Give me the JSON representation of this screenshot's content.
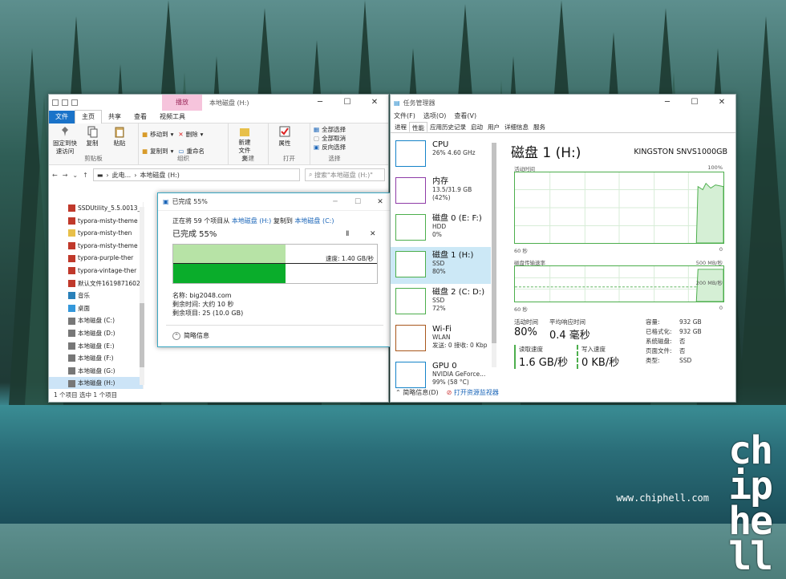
{
  "explorer": {
    "context_tab": "播放",
    "title": "本地磁盘 (H:)",
    "tabs": [
      "文件",
      "主页",
      "共享",
      "查看",
      "视频工具"
    ],
    "ribbon": {
      "clipboard": {
        "pin": "固定到快速访问",
        "copy": "复制",
        "paste": "粘贴",
        "label": "剪贴板"
      },
      "organize": {
        "move": "移动到",
        "delete": "删除",
        "copyto": "复制到",
        "rename": "重命名",
        "label": "组织"
      },
      "new": {
        "folder": "新建文件夹",
        "label": "新建"
      },
      "open": {
        "props": "属性",
        "label": "打开"
      },
      "select": {
        "all": "全部选择",
        "none": "全部取消",
        "invert": "反向选择",
        "label": "选择"
      }
    },
    "address": {
      "path1": "此电...",
      "path2": "本地磁盘 (H:)",
      "search_placeholder": "搜索\"本地磁盘 (H:)\""
    },
    "nav": [
      "SSDUtility_5.5.0013_",
      "typora-misty-theme",
      "typora-misty-then",
      "typora-misty-theme",
      "typora-purple-ther",
      "typora-vintage-ther",
      "默认文件1619871602",
      "音乐",
      "桌面",
      "本地磁盘 (C:)",
      "本地磁盘 (D:)",
      "本地磁盘 (E:)",
      "本地磁盘 (F:)",
      "本地磁盘 (G:)",
      "本地磁盘 (H:)"
    ],
    "status": "1 个项目    选中 1 个项目"
  },
  "copy": {
    "title": "已完成 55%",
    "line1_prefix": "正在将 59 个项目从",
    "line1_src": "本地磁盘 (H:)",
    "line1_mid": "复制到",
    "line1_dst": "本地磁盘 (C:)",
    "progress_text": "已完成 55%",
    "progress": 0.55,
    "speed": "速度: 1.40 GB/秒",
    "name": "名称: big2048.com",
    "remaining_time": "剩余时间: 大约 10 秒",
    "remaining_items": "剩余项目: 25 (10.0 GB)",
    "less": "简略信息",
    "pause": "Ⅱ",
    "close": "✕"
  },
  "task": {
    "title": "任务管理器",
    "menu": [
      "文件(F)",
      "选项(O)",
      "查看(V)"
    ],
    "tabs": [
      "进程",
      "性能",
      "应用历史记录",
      "启动",
      "用户",
      "详细信息",
      "服务"
    ],
    "side": [
      {
        "name": "CPU",
        "sub1": "26% 4.60 GHz",
        "sub2": "",
        "color": "#1583c8"
      },
      {
        "name": "内存",
        "sub1": "13.5/31.9 GB (42%)",
        "sub2": "",
        "color": "#8e3ca7"
      },
      {
        "name": "磁盘 0 (E: F:)",
        "sub1": "HDD",
        "sub2": "0%",
        "color": "#4cae4c"
      },
      {
        "name": "磁盘 1 (H:)",
        "sub1": "SSD",
        "sub2": "80%",
        "color": "#4cae4c"
      },
      {
        "name": "磁盘 2 (C: D:)",
        "sub1": "SSD",
        "sub2": "72%",
        "color": "#4cae4c"
      },
      {
        "name": "Wi-Fi",
        "sub1": "WLAN",
        "sub2": "发送: 0 接收: 0 Kbp",
        "color": "#a8571c"
      },
      {
        "name": "GPU 0",
        "sub1": "NVIDIA GeForce...",
        "sub2": "99% (58 °C)",
        "color": "#1583c8"
      }
    ],
    "main": {
      "title": "磁盘 1 (H:)",
      "device": "KINGSTON SNVS1000GB",
      "chart1_label": "活动时间",
      "chart1_max": "100%",
      "chart1_left": "60 秒",
      "chart1_right": "0",
      "chart2_label": "磁盘传输速率",
      "chart2_max": "500 MB/秒",
      "chart2_mid": "200 MB/秒",
      "chart2_left": "60 秒",
      "chart2_right": "0",
      "active_label": "活动时间",
      "active": "80%",
      "resp_label": "平均响应时间",
      "resp": "0.4 毫秒",
      "read_label": "读取速度",
      "read": "1.6 GB/秒",
      "write_label": "写入速度",
      "write": "0 KB/秒",
      "props": [
        [
          "容量:",
          "932 GB"
        ],
        [
          "已格式化:",
          "932 GB"
        ],
        [
          "系统磁盘:",
          "否"
        ],
        [
          "页面文件:",
          "否"
        ],
        [
          "类型:",
          "SSD"
        ]
      ]
    },
    "foot_less": "简略信息(D)",
    "foot_open": "打开资源监视器"
  },
  "watermark": {
    "logo": "chip hell",
    "url": "www.chiphell.com"
  }
}
